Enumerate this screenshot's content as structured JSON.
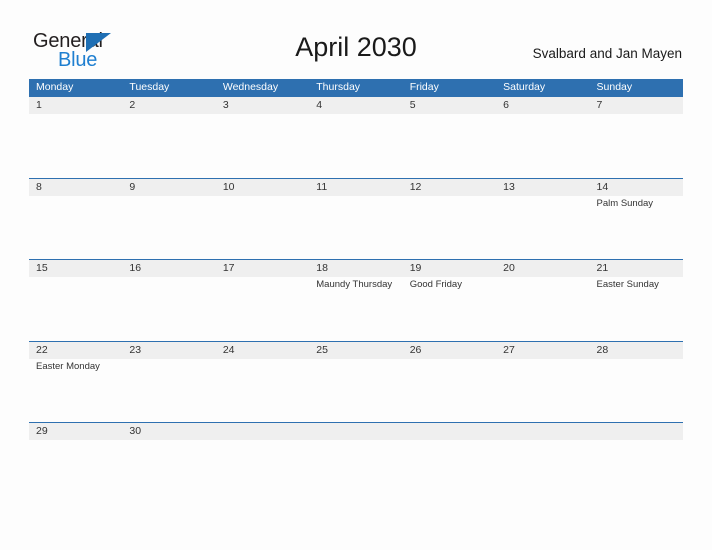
{
  "brand": {
    "name_part1": "General",
    "name_part2": "Blue",
    "accent_color": "#1f7fd0",
    "logo_icon": "triangle-flag-icon"
  },
  "header": {
    "title": "April 2030",
    "subtitle": "Svalbard and Jan Mayen"
  },
  "theme": {
    "header_blue": "#2e70b0",
    "band_gray": "#efefef",
    "page_background": "#fdfdfd",
    "text_color": "#333333"
  },
  "calendar": {
    "day_headers": [
      "Monday",
      "Tuesday",
      "Wednesday",
      "Thursday",
      "Friday",
      "Saturday",
      "Sunday"
    ],
    "weeks": [
      {
        "days": [
          {
            "date": "1",
            "event": ""
          },
          {
            "date": "2",
            "event": ""
          },
          {
            "date": "3",
            "event": ""
          },
          {
            "date": "4",
            "event": ""
          },
          {
            "date": "5",
            "event": ""
          },
          {
            "date": "6",
            "event": ""
          },
          {
            "date": "7",
            "event": ""
          }
        ]
      },
      {
        "days": [
          {
            "date": "8",
            "event": ""
          },
          {
            "date": "9",
            "event": ""
          },
          {
            "date": "10",
            "event": ""
          },
          {
            "date": "11",
            "event": ""
          },
          {
            "date": "12",
            "event": ""
          },
          {
            "date": "13",
            "event": ""
          },
          {
            "date": "14",
            "event": "Palm Sunday"
          }
        ]
      },
      {
        "days": [
          {
            "date": "15",
            "event": ""
          },
          {
            "date": "16",
            "event": ""
          },
          {
            "date": "17",
            "event": ""
          },
          {
            "date": "18",
            "event": "Maundy Thursday"
          },
          {
            "date": "19",
            "event": "Good Friday"
          },
          {
            "date": "20",
            "event": ""
          },
          {
            "date": "21",
            "event": "Easter Sunday"
          }
        ]
      },
      {
        "days": [
          {
            "date": "22",
            "event": "Easter Monday"
          },
          {
            "date": "23",
            "event": ""
          },
          {
            "date": "24",
            "event": ""
          },
          {
            "date": "25",
            "event": ""
          },
          {
            "date": "26",
            "event": ""
          },
          {
            "date": "27",
            "event": ""
          },
          {
            "date": "28",
            "event": ""
          }
        ]
      },
      {
        "days": [
          {
            "date": "29",
            "event": ""
          },
          {
            "date": "30",
            "event": ""
          },
          {
            "date": "",
            "event": ""
          },
          {
            "date": "",
            "event": ""
          },
          {
            "date": "",
            "event": ""
          },
          {
            "date": "",
            "event": ""
          },
          {
            "date": "",
            "event": ""
          }
        ]
      }
    ]
  }
}
